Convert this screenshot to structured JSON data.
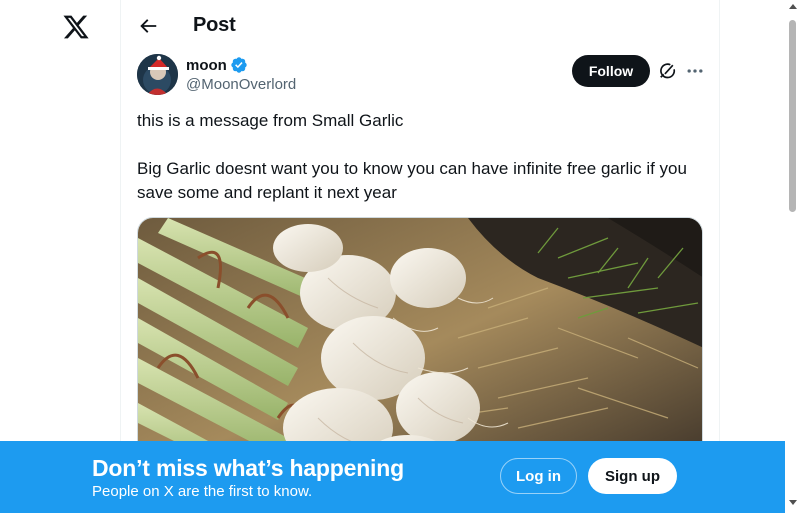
{
  "header": {
    "title": "Post"
  },
  "post": {
    "author_name": "moon",
    "author_handle": "@MoonOverlord",
    "verified": true,
    "follow_label": "Follow",
    "text_line1": "this is a message from Small Garlic",
    "text_line2": "Big Garlic doesnt want you to know you can have infinite free garlic if you save some and replant it next year"
  },
  "banner": {
    "title": "Don’t miss what’s happening",
    "subtitle": "People on X are the first to know.",
    "login_label": "Log in",
    "signup_label": "Sign up"
  },
  "icons": {
    "logo": "x-logo-icon",
    "back": "back-arrow-icon",
    "verified": "verified-badge-icon",
    "grok": "grok-icon",
    "more": "more-icon"
  },
  "colors": {
    "accent": "#1d9bf0",
    "text": "#0f1419",
    "muted": "#536471",
    "follow_bg": "#0f1419"
  }
}
